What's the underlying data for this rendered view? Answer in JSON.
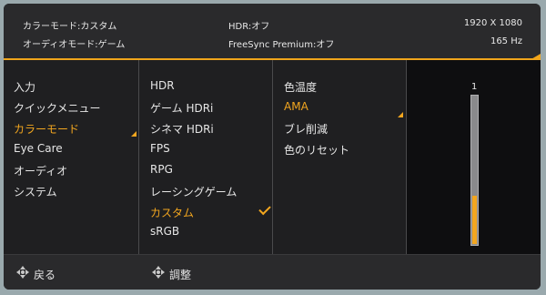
{
  "info": {
    "color_mode": "カラーモード:カスタム",
    "audio_mode": "オーディオモード:ゲーム",
    "hdr": "HDR:オフ",
    "freesync": "FreeSync Premium:オフ",
    "resolution": "1920 X 1080",
    "refresh": "165 Hz"
  },
  "menu": {
    "main": [
      "入力",
      "クイックメニュー",
      "カラーモード",
      "Eye Care",
      "オーディオ",
      "システム"
    ],
    "main_active": "カラーモード",
    "modes": [
      "HDR",
      "ゲーム HDRi",
      "シネマ HDRi",
      "FPS",
      "RPG",
      "レーシングゲーム",
      "カスタム",
      "sRGB"
    ],
    "modes_selected": "カスタム",
    "settings": [
      "色温度",
      "AMA",
      "ブレ削減",
      "色のリセット"
    ],
    "settings_active": "AMA"
  },
  "slider": {
    "value_label": "1",
    "fill_fraction": 0.33
  },
  "bottom": {
    "back_label": "戻る",
    "adjust_label": "調整"
  },
  "colors": {
    "accent": "#f2a61f",
    "background": "#1f1f21"
  },
  "icons": [
    "dpad-icon",
    "chevron-icon",
    "checkmark-icon"
  ]
}
